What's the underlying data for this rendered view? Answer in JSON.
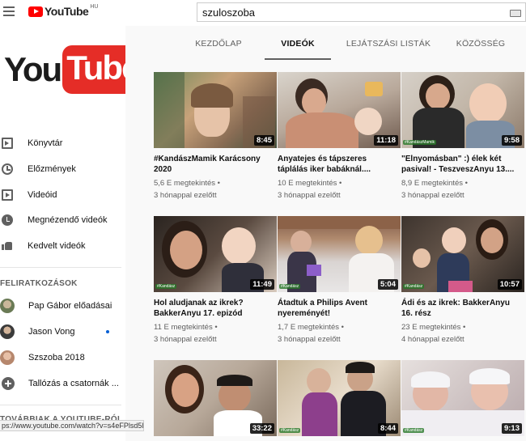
{
  "header": {
    "logo_word": "YouTube",
    "country": "HU",
    "search_value": "szuloszoba"
  },
  "channel_logo": {
    "you": "You",
    "tube": "Tube"
  },
  "sidebar": {
    "items": [
      {
        "label": "Könyvtár",
        "icon": "library-icon"
      },
      {
        "label": "Előzmények",
        "icon": "history-icon"
      },
      {
        "label": "Videóid",
        "icon": "your-videos-icon"
      },
      {
        "label": "Megnézendő videók",
        "icon": "watch-later-icon"
      },
      {
        "label": "Kedvelt videók",
        "icon": "liked-videos-icon"
      }
    ],
    "subscriptions_title": "FELIRATKOZÁSOK",
    "subscriptions": [
      {
        "label": "Pap Gábor előadásai"
      },
      {
        "label": "Jason Vong"
      },
      {
        "label": "Szszoba 2018"
      },
      {
        "label": "Tallózás a csatornák ..."
      }
    ],
    "more_title": "TOVÁBBIAK A YOUTUBE-RÓL"
  },
  "tabs": [
    {
      "label": "KEZDŐLAP"
    },
    {
      "label": "VIDEÓK"
    },
    {
      "label": "LEJÁTSZÁSI LISTÁK"
    },
    {
      "label": "KÖZÖSSÉG"
    }
  ],
  "videos": [
    {
      "title": "#KandászMamik Karácsony 2020",
      "views": "5,6 E megtekintés •",
      "age": "3 hónappal ezelőtt",
      "duration": "8:45"
    },
    {
      "title": "Anyatejes és tápszeres táplálás iker babáknál....",
      "views": "10 E megtekintés •",
      "age": "3 hónappal ezelőtt",
      "duration": "11:18"
    },
    {
      "title": "\"Elnyomásban\" :) élek két pasival! - TeszveszAnyu 13....",
      "views": "8,9 E megtekintés •",
      "age": "3 hónappal ezelőtt",
      "duration": "9:58"
    },
    {
      "title": "Hol aludjanak az ikrek? BakkerAnyu 17. epizód",
      "views": "11 E megtekintés •",
      "age": "3 hónappal ezelőtt",
      "duration": "11:49"
    },
    {
      "title": "Átadtuk a Philips Avent nyereményét!",
      "views": "1,7 E megtekintés •",
      "age": "3 hónappal ezelőtt",
      "duration": "5:04"
    },
    {
      "title": "Ádi és az ikrek: BakkerAnyu 16. rész",
      "views": "23 E megtekintés •",
      "age": "4 hónappal ezelőtt",
      "duration": "10:57"
    },
    {
      "title": "",
      "views": "",
      "age": "",
      "duration": "33:22"
    },
    {
      "title": "",
      "views": "",
      "age": "",
      "duration": "8:44"
    },
    {
      "title": "",
      "views": "",
      "age": "",
      "duration": "9:13"
    }
  ],
  "status_url": "ps://www.youtube.com/watch?v=s4eFPlsd5lA",
  "colors": {
    "brand_red": "#ff0000",
    "logo_red": "#e52d27",
    "text_secondary": "#606060",
    "content_bg": "#f9f9f9"
  }
}
